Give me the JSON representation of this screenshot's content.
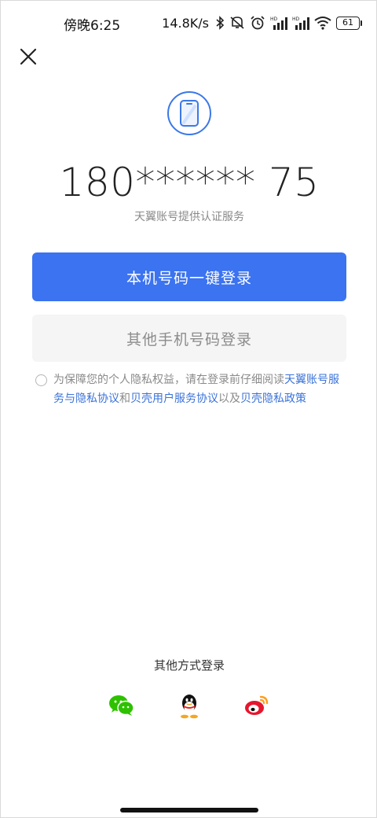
{
  "status_bar": {
    "time": "傍晚6:25",
    "net_speed": "14.8K/s",
    "battery": "61",
    "icons": [
      "bluetooth-icon",
      "mute-icon",
      "alarm-icon",
      "hd-signal-icon",
      "hd-signal-icon",
      "wifi-icon",
      "battery-icon"
    ]
  },
  "header": {
    "close_icon": "close-icon"
  },
  "login": {
    "phone_icon": "phone-icon",
    "masked_number": "180****** 75",
    "provider_note": "天翼账号提供认证服务",
    "one_tap_label": "本机号码一键登录",
    "other_phone_label": "其他手机号码登录"
  },
  "agreement": {
    "prefix": "为保障您的个人隐私权益，请在登录前仔细阅读",
    "link1": "天翼账号服务与隐私协议",
    "and": "和",
    "link2": "贝壳用户服务协议",
    "also": "以及",
    "link3": "贝壳隐私政策"
  },
  "other_login": {
    "label": "其他方式登录",
    "methods": [
      "wechat-icon",
      "qq-icon",
      "weibo-icon"
    ]
  },
  "colors": {
    "primary": "#3b73f0",
    "link": "#3b73d8",
    "secondary_bg": "#f5f5f5",
    "wechat": "#2dc100",
    "weibo": "#e6162d",
    "weibo_accent": "#ff9e19"
  }
}
